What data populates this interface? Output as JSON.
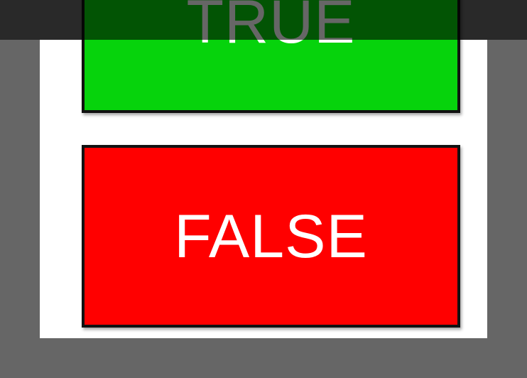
{
  "buttons": {
    "true_label": "TRUE",
    "false_label": "FALSE"
  },
  "colors": {
    "backdrop": "#666666",
    "panel": "#ffffff",
    "true_fill": "#06d30c",
    "false_fill": "#ff0000",
    "label_text": "#ffffff",
    "border": "#111111"
  }
}
